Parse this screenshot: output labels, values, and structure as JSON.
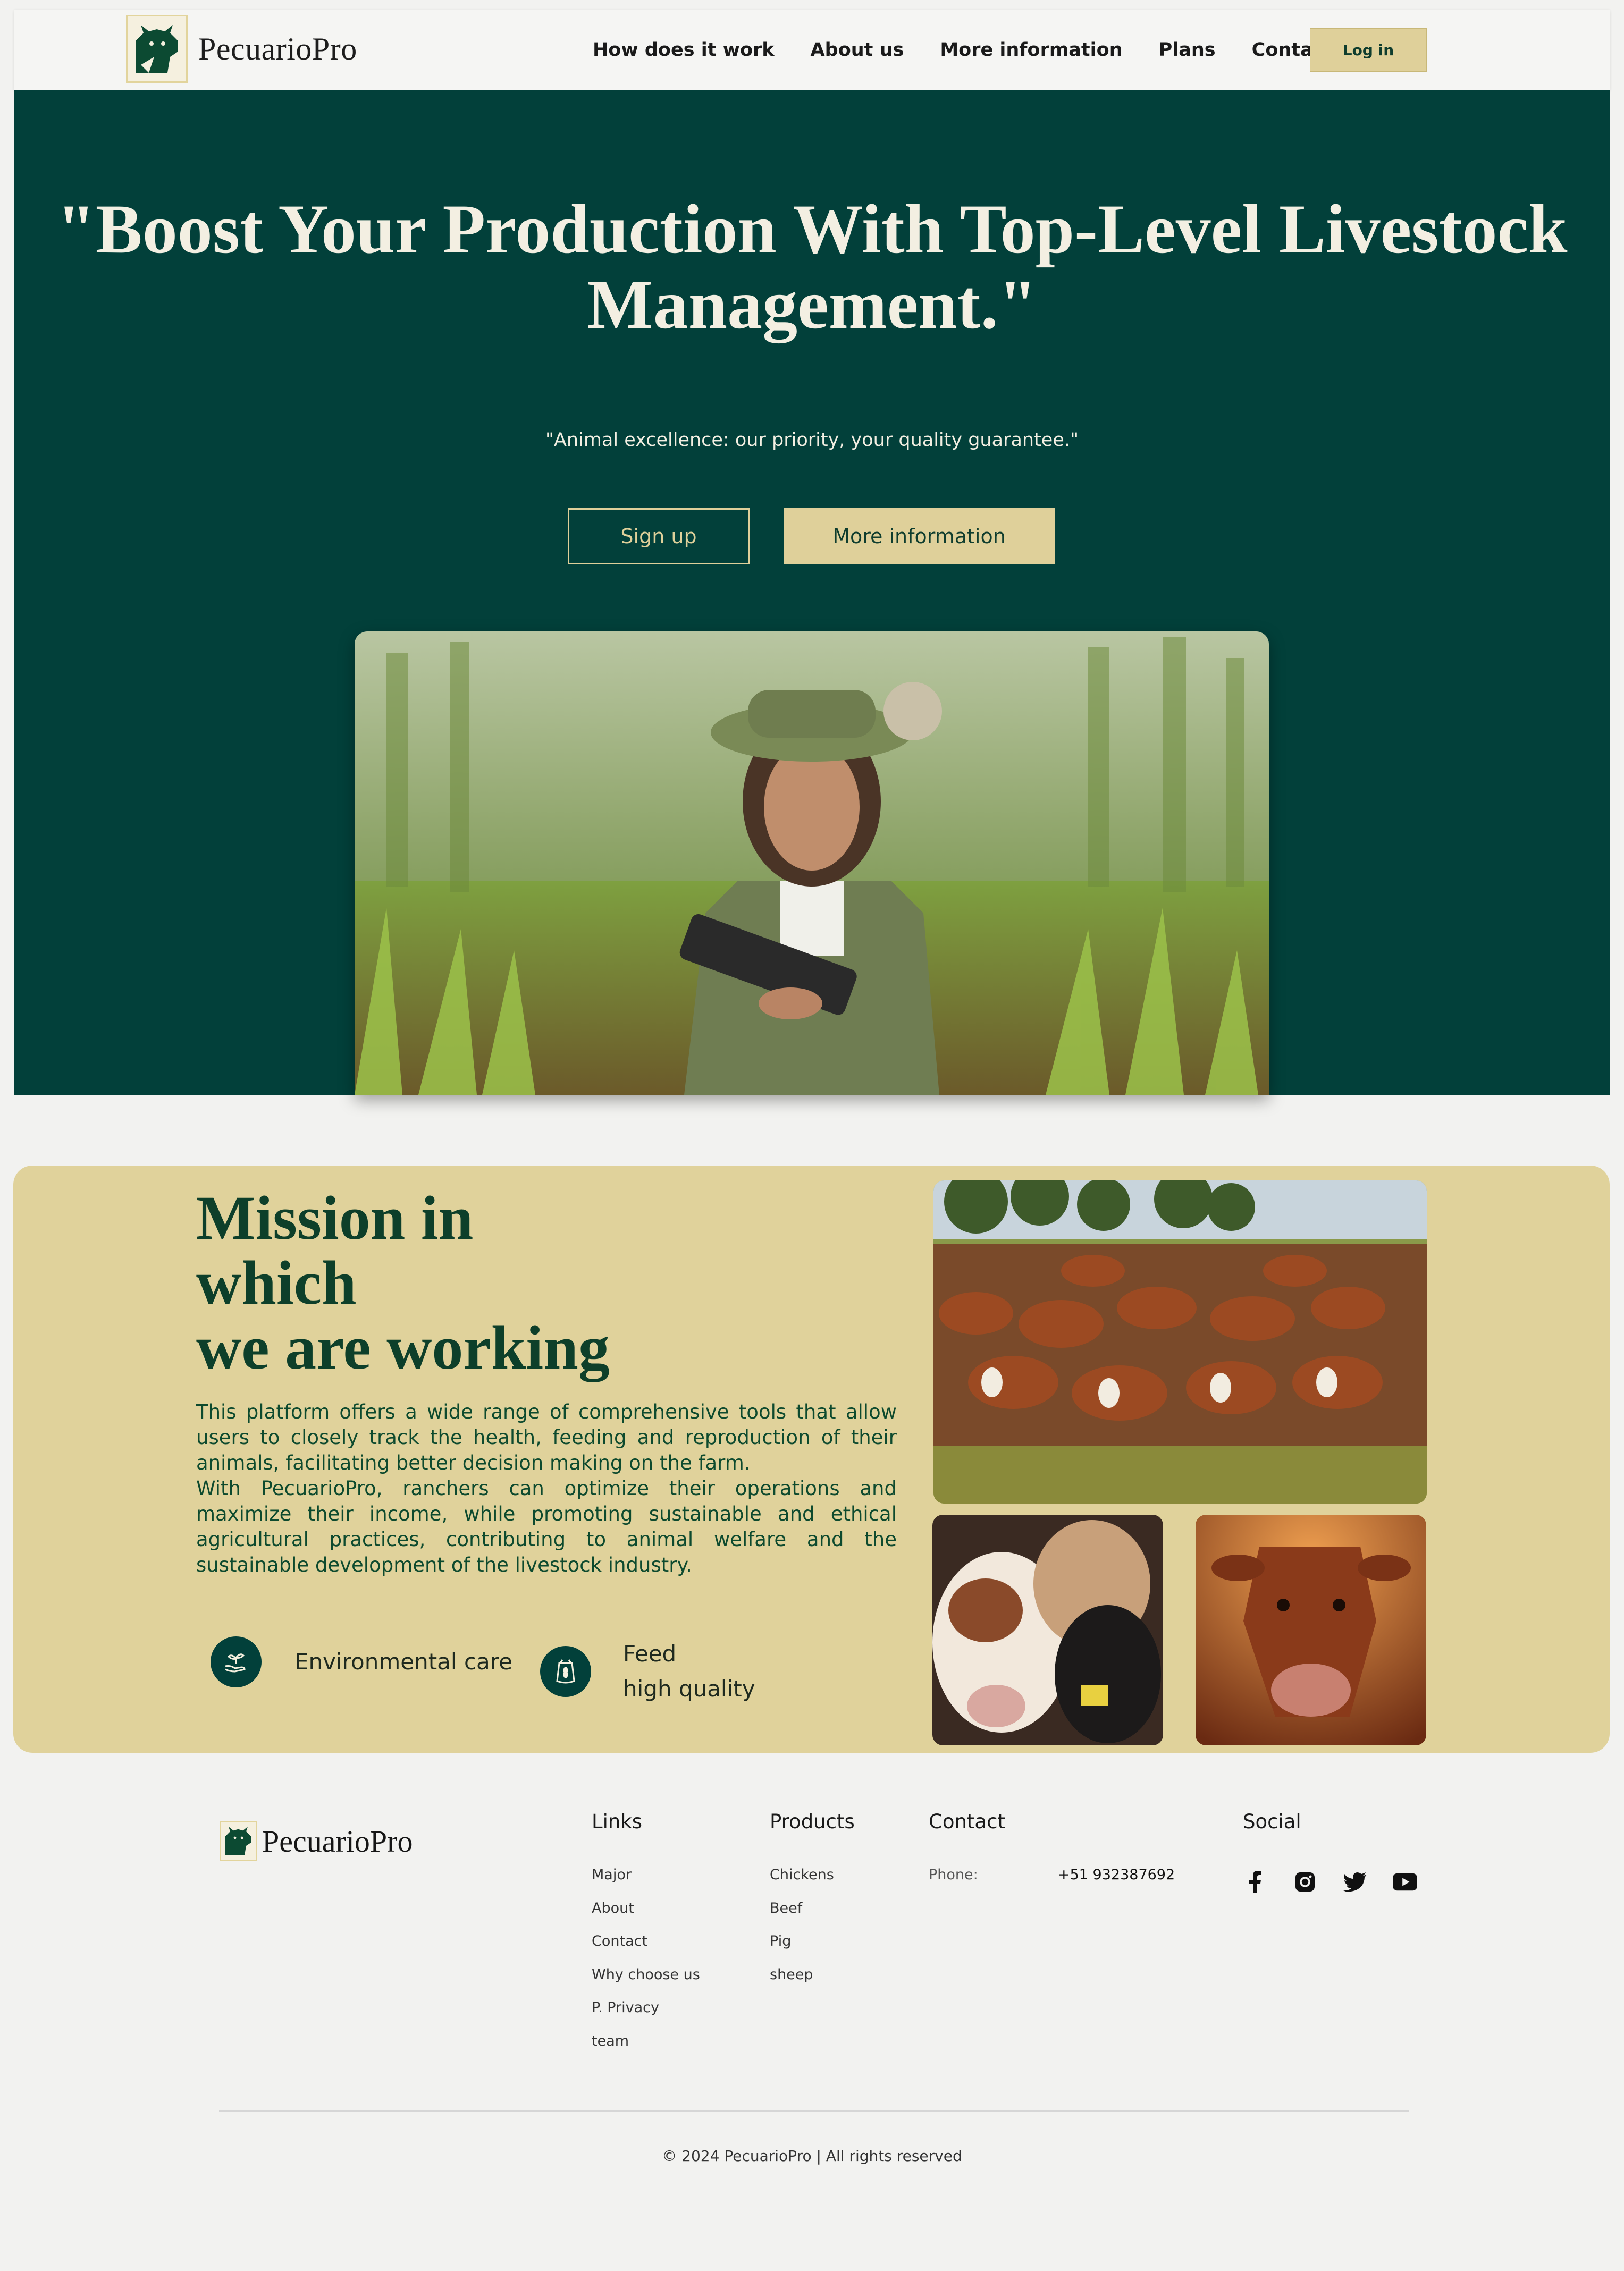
{
  "nav": {
    "brand": "PecuarioPro",
    "links": [
      "How does it work",
      "About us",
      "More information",
      "Plans",
      "Contact us"
    ],
    "login_label": "Log in"
  },
  "hero": {
    "title": "\"Boost Your Production With Top-Level Livestock Management.\"",
    "subtitle": "\"Animal excellence: our priority, your quality guarantee.\"",
    "signup_label": "Sign up",
    "more_label": "More information"
  },
  "mission": {
    "title": "Mission in\nwhich\nwe are working",
    "paragraphs": [
      "This platform offers a wide range of comprehensive tools that allow users to closely track the health, feeding and reproduction of their animals, facilitating better decision making on the farm.",
      "With PecuarioPro, ranchers can optimize their operations and maximize their income, while promoting sustainable and ethical agricultural practices, contributing to animal welfare and the sustainable development of the livestock industry."
    ],
    "features": [
      {
        "label": "Environmental care",
        "icon": "plant-hand-icon"
      },
      {
        "label": "Feed\n high quality",
        "icon": "feed-bag-icon"
      }
    ]
  },
  "footer": {
    "brand": "PecuarioPro",
    "links_heading": "Links",
    "links": [
      "Major",
      "About",
      "Contact",
      "Why choose us",
      "P. Privacy",
      "team"
    ],
    "products_heading": "Products",
    "products": [
      "Chickens",
      "Beef",
      "Pig",
      "sheep"
    ],
    "contact_heading": "Contact",
    "phone_label": "Phone:",
    "phone": "+51 932387692",
    "social_heading": "Social",
    "social_icons": [
      "facebook-icon",
      "instagram-icon",
      "twitter-icon",
      "youtube-icon"
    ],
    "copyright": "© 2024 PecuarioPro | All rights reserved"
  },
  "colors": {
    "dark_green": "#02403a",
    "gold": "#dfd09a",
    "mission_bg": "#e0d29b",
    "title_green": "#0d3f2a"
  }
}
